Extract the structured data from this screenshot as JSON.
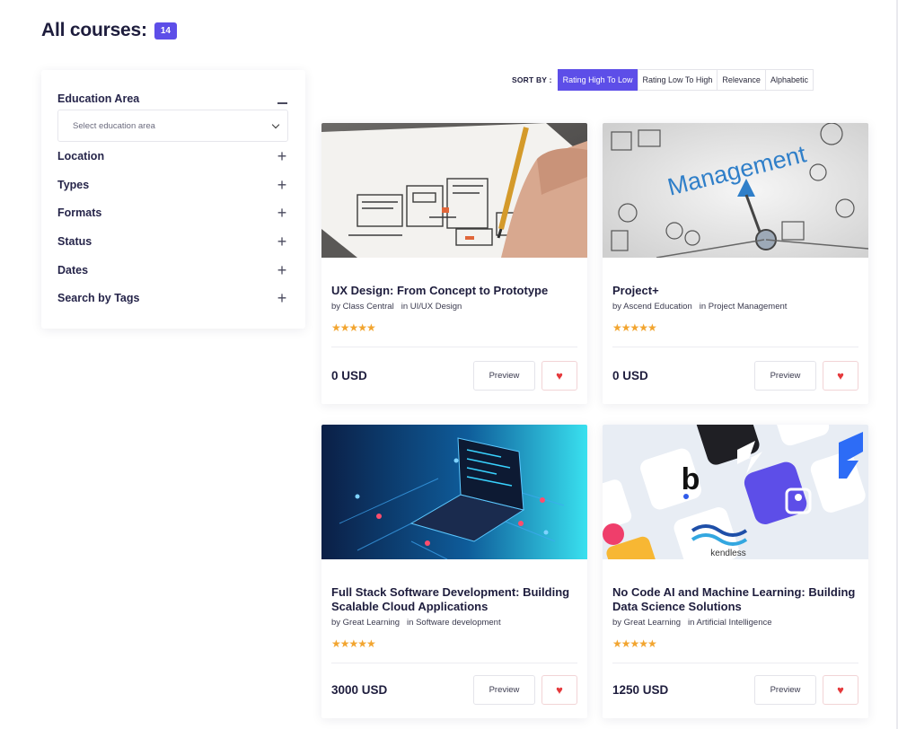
{
  "header": {
    "title": "All courses:",
    "count": "14"
  },
  "filters": {
    "education_area": {
      "label": "Education Area",
      "placeholder": "Select education area"
    },
    "items": [
      {
        "label": "Location"
      },
      {
        "label": "Types"
      },
      {
        "label": "Formats"
      },
      {
        "label": "Status"
      },
      {
        "label": "Dates"
      },
      {
        "label": "Search by Tags"
      }
    ]
  },
  "sort": {
    "label": "SORT BY :",
    "options": [
      "Rating High To Low",
      "Rating Low To High",
      "Relevance",
      "Alphabetic"
    ],
    "active": "Rating High To Low"
  },
  "courses": [
    {
      "title": "UX Design: From Concept to Prototype",
      "by": "by Class Central",
      "in": "in UI/UX Design",
      "rating": "★★★★★",
      "price": "0 USD",
      "preview": "Preview",
      "image": "ux-sketch-image"
    },
    {
      "title": "Project+",
      "by": "by Ascend Education",
      "in": "in Project Management",
      "rating": "★★★★★",
      "price": "0 USD",
      "preview": "Preview",
      "image": "management-compass-image",
      "image_text": "Management"
    },
    {
      "title": "Full Stack Software Development: Building Scalable Cloud Applications",
      "by": "by Great Learning",
      "in": "in Software development",
      "rating": "★★★★★",
      "price": "3000 USD",
      "preview": "Preview",
      "image": "laptop-network-image"
    },
    {
      "title": "No Code AI and Machine Learning: Building Data Science Solutions",
      "by": "by Great Learning",
      "in": "in Artificial Intelligence",
      "rating": "★★★★★",
      "price": "1250 USD",
      "preview": "Preview",
      "image": "nocode-logos-image",
      "image_text": "kendless"
    }
  ],
  "colors": {
    "accent": "#5d4ee8",
    "star": "#f2a530",
    "heart": "#e5383b",
    "text": "#1e1d3d"
  },
  "icons": {
    "expand": "plus-icon",
    "collapse": "minus-icon",
    "dropdown": "chevron-down-icon",
    "favorite": "heart-icon",
    "rating": "star-icon"
  }
}
